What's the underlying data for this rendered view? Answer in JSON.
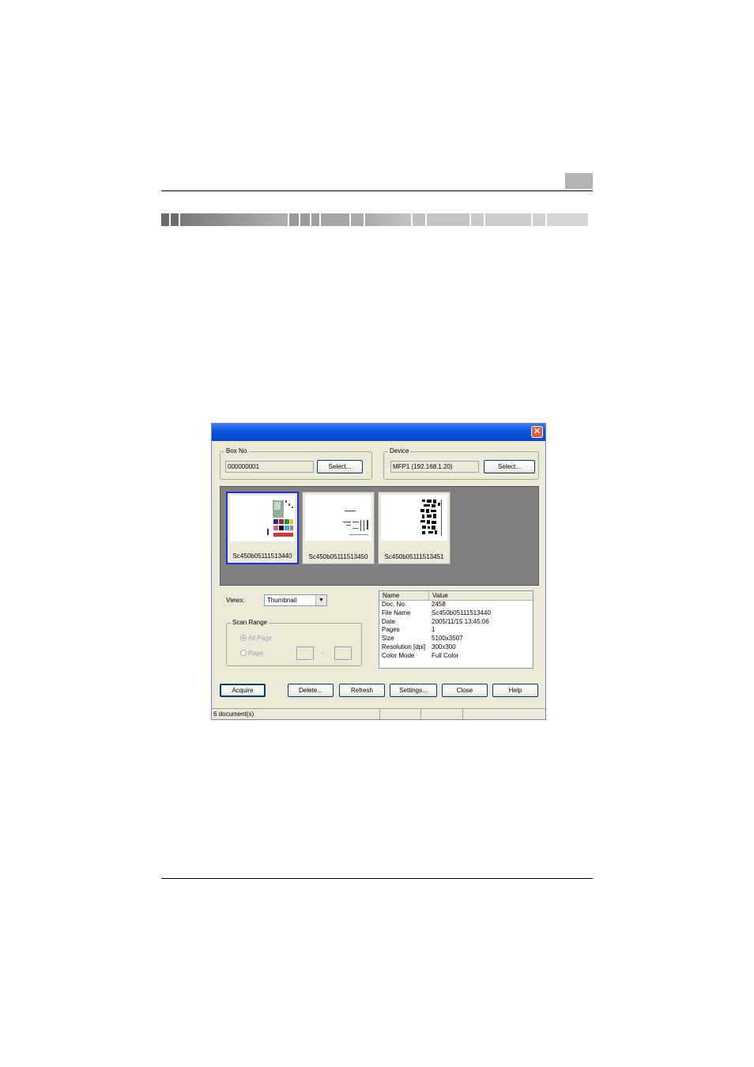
{
  "dialog": {
    "box_group": {
      "label": "Box No.",
      "value": "000000001",
      "select_label": "Select..."
    },
    "device_group": {
      "label": "Device",
      "value": "MFP1 (192.168.1.20)",
      "select_label": "Select..."
    },
    "thumbnails": [
      {
        "caption": "Sc450b05111513440",
        "selected": true
      },
      {
        "caption": "Sc450b05111513450",
        "selected": false
      },
      {
        "caption": "Sc450b05111513451",
        "selected": false
      }
    ],
    "views": {
      "label": "Views:",
      "value": "Thumbnail"
    },
    "scan_range": {
      "label": "Scan Range",
      "all_page_label": "All Page",
      "page_label": "Page",
      "dash": "-"
    },
    "properties": {
      "headers": [
        "Name",
        "Value"
      ],
      "rows": [
        [
          "Doc. No.",
          "2458"
        ],
        [
          "File Name",
          "Sc450b05111513440"
        ],
        [
          "Date",
          "2005/11/15 13:45:06"
        ],
        [
          "Pages",
          "1"
        ],
        [
          "Size",
          "5100x3507"
        ],
        [
          "Resolution [dpi]",
          "300x300"
        ],
        [
          "Color Mode",
          "Full Color"
        ]
      ]
    },
    "buttons": {
      "acquire": "Acquire",
      "delete": "Delete...",
      "refresh": "Refresh",
      "settings": "Settings...",
      "close": "Close",
      "help": "Help"
    },
    "status": "6 document(s)"
  }
}
